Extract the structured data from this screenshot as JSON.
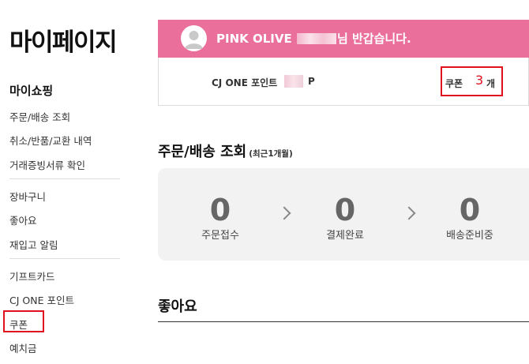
{
  "page": {
    "title": "마이페이지"
  },
  "sidebar": {
    "heading": "마이쇼핑",
    "groups": [
      [
        "주문/배송 조회",
        "취소/반품/교환 내역",
        "거래증빙서류 확인"
      ],
      [
        "장바구니",
        "좋아요",
        "재입고 알림"
      ],
      [
        "기프트카드",
        "CJ ONE 포인트",
        "쿠폰",
        "예치금"
      ]
    ]
  },
  "welcome": {
    "prefix": "PINK OLIVE",
    "suffix": "님 반갑습니다."
  },
  "points": {
    "label": "CJ ONE 포인트",
    "unit": "P"
  },
  "coupon": {
    "label": "쿠폰",
    "count": "3",
    "unit": "개"
  },
  "orders": {
    "title": "주문/배송 조회",
    "subtitle": "(최근1개월)",
    "steps": [
      {
        "count": "0",
        "label": "주문접수"
      },
      {
        "count": "0",
        "label": "결제완료"
      },
      {
        "count": "0",
        "label": "배송준비중"
      }
    ]
  },
  "likes": {
    "title": "좋아요"
  },
  "colors": {
    "banner": "#ea6f9b",
    "highlight": "#e2111e",
    "order_bg": "#f2f2f2"
  }
}
